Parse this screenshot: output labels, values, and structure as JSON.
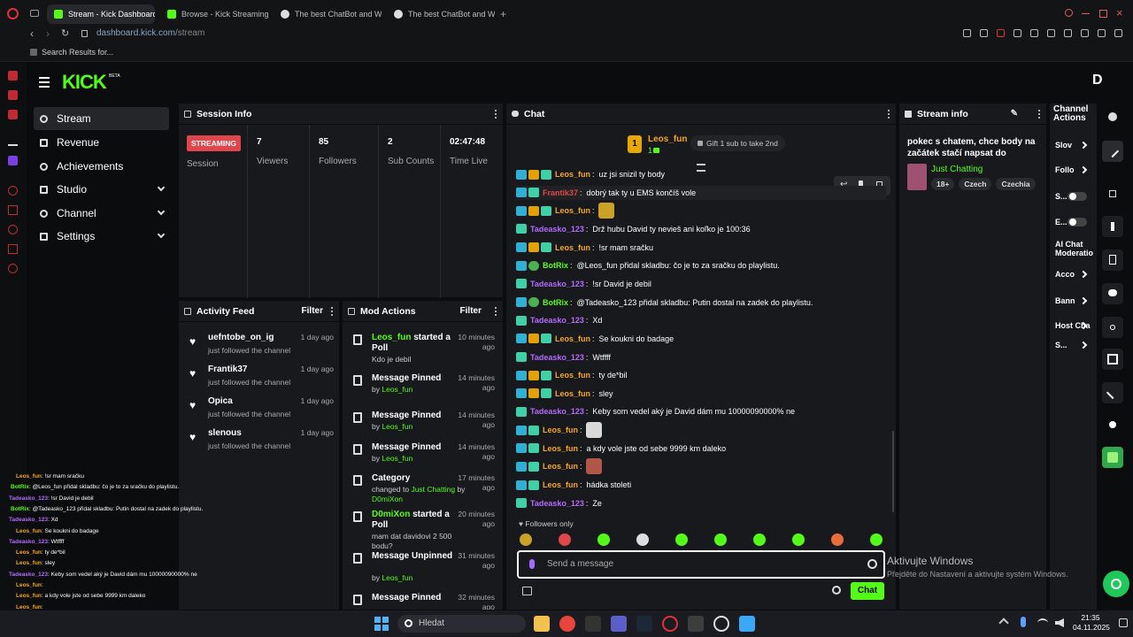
{
  "browser": {
    "tabs": [
      {
        "label": "Stream - Kick Dashboard",
        "active": true,
        "favicon": "kick"
      },
      {
        "label": "Browse - Kick Streaming",
        "active": false,
        "favicon": "kick"
      },
      {
        "label": "The best ChatBot and Wi",
        "active": false,
        "favicon": "bot"
      },
      {
        "label": "The best ChatBot and Wi",
        "active": false,
        "favicon": "bot"
      }
    ],
    "url_domain": "dashboard.kick.com",
    "url_path": "/stream",
    "bookmark": "Search Results for..."
  },
  "brand": {
    "logo": "KICK",
    "badge": "BETA",
    "avatar_letter": "D"
  },
  "sidebar": {
    "items": [
      {
        "label": "Stream",
        "icon": "broadcast-icon",
        "selected": true,
        "expandable": false
      },
      {
        "label": "Revenue",
        "icon": "money-icon",
        "selected": false,
        "expandable": false
      },
      {
        "label": "Achievements",
        "icon": "trophy-icon",
        "selected": false,
        "expandable": false
      },
      {
        "label": "Studio",
        "icon": "gear-icon",
        "selected": false,
        "expandable": true
      },
      {
        "label": "Channel",
        "icon": "list-icon",
        "selected": false,
        "expandable": true
      },
      {
        "label": "Settings",
        "icon": "gear-icon",
        "selected": false,
        "expandable": true
      }
    ]
  },
  "session": {
    "title": "Session Info",
    "status_badge": "STREAMING",
    "status_label": "Session",
    "stats": [
      {
        "value": "7",
        "label": "Viewers"
      },
      {
        "value": "85",
        "label": "Followers"
      },
      {
        "value": "2",
        "label": "Sub Counts"
      },
      {
        "value": "02:47:48",
        "label": "Time Live"
      }
    ]
  },
  "activity": {
    "title": "Activity Feed",
    "filter": "Filter",
    "items": [
      {
        "name": "uefntobe_on_ig",
        "text": "just followed the channel",
        "time": "1 day ago"
      },
      {
        "name": "Frantik37",
        "text": "just followed the channel",
        "time": "1 day ago"
      },
      {
        "name": "Opica",
        "text": "just followed the channel",
        "time": "1 day ago"
      },
      {
        "name": "slenous",
        "text": "just followed the channel",
        "time": "1 day ago"
      }
    ]
  },
  "mod_actions": {
    "title": "Mod Actions",
    "filter": "Filter",
    "items": [
      {
        "icon": "poll-icon",
        "actor": "Leos_fun",
        "action": "started a Poll",
        "detail": "Kdo je debil",
        "by": "",
        "time": "10 minutes ago"
      },
      {
        "icon": "pin-icon",
        "actor": "",
        "action": "Message Pinned",
        "detail": "by",
        "by": "Leos_fun",
        "time": "14 minutes ago"
      },
      {
        "icon": "pin-icon",
        "actor": "",
        "action": "Message Pinned",
        "detail": "by",
        "by": "Leos_fun",
        "time": "14 minutes ago"
      },
      {
        "icon": "pin-icon",
        "actor": "",
        "action": "Message Pinned",
        "detail": "by",
        "by": "Leos_fun",
        "time": "14 minutes ago"
      },
      {
        "icon": "category-icon",
        "actor": "",
        "action": "Category",
        "detail": "changed to",
        "by": "Just Chatting",
        "by2": "D0miXon",
        "time": "17 minutes ago"
      },
      {
        "icon": "poll-icon",
        "actor": "D0miXon",
        "action": "started a Poll",
        "detail": "mam dat davidovi 2 500 bodu?",
        "by": "",
        "time": "20 minutes ago"
      },
      {
        "icon": "unpin-icon",
        "actor": "",
        "action": "Message Unpinned",
        "detail": "by",
        "by": "Leos_fun",
        "time": "31 minutes ago"
      },
      {
        "icon": "pin-icon",
        "actor": "",
        "action": "Message Pinned",
        "detail": "",
        "by": "",
        "time": "32 minutes ago"
      }
    ]
  },
  "chat": {
    "title": "Chat",
    "pinned_user": "Leos_fun",
    "pinned_count": "1",
    "gift_text": "Gift 1 sub to take 2nd",
    "followers_only": "Followers only",
    "placeholder": "Send a message",
    "send_label": "Chat",
    "messages": [
      {
        "user": "Leos_fun",
        "color": "#f5a623",
        "text": "uz jsi snizil ty body",
        "badges": [
          "b1",
          "b2",
          "b3"
        ]
      },
      {
        "user": "Frantik37",
        "color": "#e0474c",
        "text": "dobrý tak ty u EMS končíš vole",
        "badges": [
          "b1",
          "b3"
        ]
      },
      {
        "user": "Leos_fun",
        "color": "#f5a623",
        "text": "",
        "badges": [
          "b1",
          "b2",
          "b3"
        ],
        "emote": "#c9a227"
      },
      {
        "user": "Tadeasko_123",
        "color": "#b36bff",
        "text": "Drž hubu David ty nevieš ani koľko je 100:36",
        "badges": [
          "b3"
        ]
      },
      {
        "user": "Leos_fun",
        "color": "#f5a623",
        "text": "!sr mam sračku",
        "badges": [
          "b1",
          "b2",
          "b3"
        ]
      },
      {
        "user": "BotRix",
        "color": "#53fc18",
        "text": "@Leos_fun přidal skladbu: čo je to za sračku do playlistu.",
        "badges": [
          "b1",
          "b4"
        ]
      },
      {
        "user": "Tadeasko_123",
        "color": "#b36bff",
        "text": "!sr David je debil",
        "badges": [
          "b3"
        ]
      },
      {
        "user": "BotRix",
        "color": "#53fc18",
        "text": "@Tadeasko_123 přidal skladbu: Putin dostal na zadek do playlistu.",
        "badges": [
          "b1",
          "b4"
        ]
      },
      {
        "user": "Tadeasko_123",
        "color": "#b36bff",
        "text": "Xd",
        "badges": [
          "b3"
        ]
      },
      {
        "user": "Leos_fun",
        "color": "#f5a623",
        "text": "Se koukni do badage",
        "badges": [
          "b1",
          "b2",
          "b3"
        ]
      },
      {
        "user": "Tadeasko_123",
        "color": "#b36bff",
        "text": "Wtffff",
        "badges": [
          "b3"
        ]
      },
      {
        "user": "Leos_fun",
        "color": "#f5a623",
        "text": "ty de*bil",
        "badges": [
          "b1",
          "b2",
          "b3"
        ]
      },
      {
        "user": "Leos_fun",
        "color": "#f5a623",
        "text": "sley",
        "badges": [
          "b1",
          "b2",
          "b3"
        ]
      },
      {
        "user": "Tadeasko_123",
        "color": "#b36bff",
        "text": "Keby som vedel aký je David dám mu 10000090000% ne",
        "badges": [
          "b3"
        ]
      },
      {
        "user": "Leos_fun",
        "color": "#f5a623",
        "text": "",
        "badges": [
          "b1",
          "b3"
        ],
        "emote": "#d9d9d9"
      },
      {
        "user": "Leos_fun",
        "color": "#f5a623",
        "text": "a kdy vole jste od sebe 9999 km daleko",
        "badges": [
          "b1",
          "b3"
        ]
      },
      {
        "user": "Leos_fun",
        "color": "#f5a623",
        "text": "",
        "badges": [
          "b1",
          "b3"
        ],
        "emote": "#b0574a"
      },
      {
        "user": "Leos_fun",
        "color": "#f5a623",
        "text": "hádka stoleti",
        "badges": [
          "b1",
          "b3"
        ]
      },
      {
        "user": "Tadeasko_123",
        "color": "#b36bff",
        "text": "Ze",
        "badges": [
          "b3"
        ]
      }
    ]
  },
  "stream_info": {
    "title": "Stream info",
    "stream_title": "pokec s chatem, chce body na začátek stačí napsat do chatu...",
    "category": "Just Chatting",
    "tags": [
      "18+",
      "Czech",
      "Czechia"
    ]
  },
  "channel_actions": {
    "title": "Channel Actions",
    "items": [
      {
        "label": "Slov",
        "type": "link"
      },
      {
        "label": "Follo",
        "type": "link"
      },
      {
        "label": "S...",
        "type": "toggle"
      },
      {
        "label": "E...",
        "type": "toggle"
      },
      {
        "label": "AI Chat Moderatio",
        "type": "heading"
      },
      {
        "label": "Acco",
        "type": "link"
      },
      {
        "label": "Bann",
        "type": "link"
      },
      {
        "label": "Host Cha",
        "type": "link"
      },
      {
        "label": "S...",
        "type": "link"
      }
    ]
  },
  "watermark": {
    "line1": "Aktivujte Windows",
    "line2": "Přejděte do Nastavení a aktivujte systém Windows."
  },
  "overlay_chat": [
    {
      "u": "Leos_fun",
      "t": ": !sr mam sračku",
      "c": "#f5a623"
    },
    {
      "u": "BotRix",
      "t": ": @Leos_fun přidal skladbu: čo je to za sračku do playlistu.",
      "c": "#53fc18"
    },
    {
      "u": "Tadeasko_123",
      "t": ": !sr David je debil",
      "c": "#b36bff"
    },
    {
      "u": "BotRix",
      "t": ": @Tadeasko_123 přidal skladbu: Putin dostal na zadek do playlistu.",
      "c": "#53fc18"
    },
    {
      "u": "Tadeasko_123",
      "t": ": Xd",
      "c": "#b36bff"
    },
    {
      "u": "Leos_fun",
      "t": ": Se koukni do badage",
      "c": "#f5a623"
    },
    {
      "u": "Tadeasko_123",
      "t": ": Wtffff",
      "c": "#b36bff"
    },
    {
      "u": "Leos_fun",
      "t": ": ty de*bil",
      "c": "#f5a623"
    },
    {
      "u": "Leos_fun",
      "t": ": sley",
      "c": "#f5a623"
    },
    {
      "u": "Tadeasko_123",
      "t": ": Keby som vedel aký je David dám mu 10000090000% ne",
      "c": "#b36bff"
    },
    {
      "u": "Leos_fun",
      "t": ": ",
      "c": "#f5a623"
    },
    {
      "u": "Leos_fun",
      "t": ": a kdy vole jste od sebe 9999 km daleko",
      "c": "#f5a623"
    },
    {
      "u": "Leos_fun",
      "t": ": ",
      "c": "#f5a623"
    },
    {
      "u": "Leos_fun",
      "t": ": hádka stoleti",
      "c": "#f5a623"
    },
    {
      "u": "Tadeasko_123",
      "t": ": Ze",
      "c": "#b36bff"
    }
  ],
  "taskbar": {
    "search": "Hledat",
    "time": "21:35",
    "date": "04.11.2025"
  },
  "colors": {
    "accent": "#53fc18",
    "streaming": "#e0474c",
    "panel": "#18191c"
  }
}
